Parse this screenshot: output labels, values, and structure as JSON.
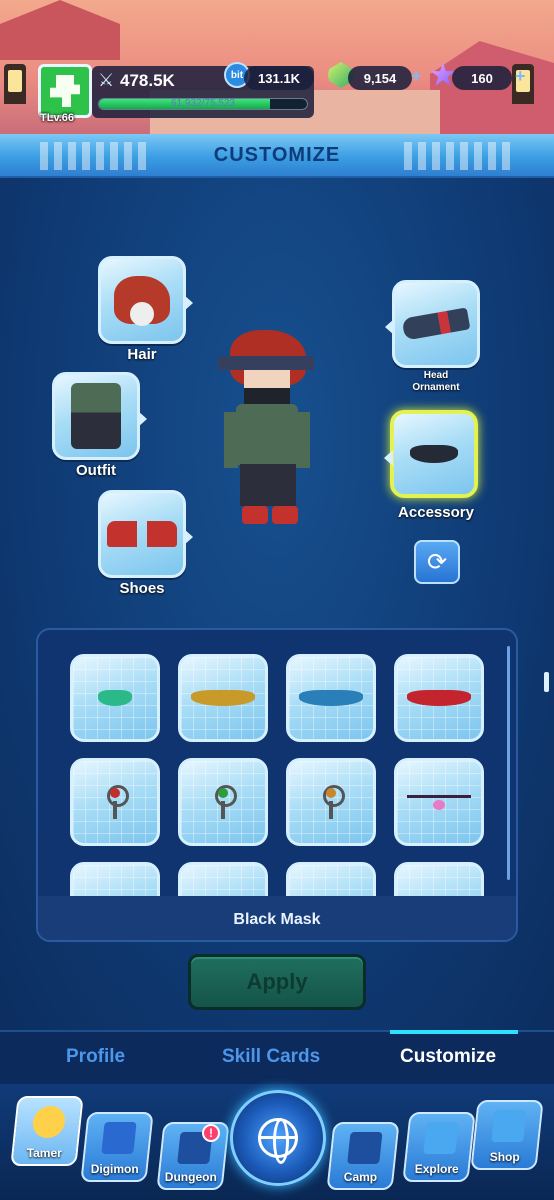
{
  "status": {
    "tamer_level": "TLv.66",
    "power": "478.5K",
    "exp_text": "61,932/75,523",
    "exp_fraction": 0.82,
    "bits": "131.1K",
    "bit_icon_label": "bit",
    "gems": "9,154",
    "stars": "160"
  },
  "header": {
    "title": "CUSTOMIZE"
  },
  "slots": {
    "hair": "Hair",
    "outfit": "Outfit",
    "shoes": "Shoes",
    "head_ornament_line1": "Head",
    "head_ornament_line2": "Ornament",
    "accessory": "Accessory"
  },
  "items": {
    "row1": [
      {
        "icon": "green-mask-icon",
        "color": "#2bb98a"
      },
      {
        "icon": "gold-mask-icon",
        "color": "#c89a2a"
      },
      {
        "icon": "blue-mask-icon",
        "color": "#2a7fb8"
      },
      {
        "icon": "red-mask-icon",
        "color": "#c3242d"
      }
    ],
    "row2": [
      {
        "icon": "red-charm-icon",
        "color": "#c0302d"
      },
      {
        "icon": "green-charm-icon",
        "color": "#2f9a3a"
      },
      {
        "icon": "orange-charm-icon",
        "color": "#c8872a"
      },
      {
        "icon": "glasses-icon",
        "color": "#e87ac8"
      }
    ],
    "selected_name": "Black Mask"
  },
  "apply_label": "Apply",
  "tabs": {
    "profile": "Profile",
    "skill_cards": "Skill Cards",
    "customize": "Customize"
  },
  "nav": {
    "tamer": "Tamer",
    "digimon": "Digimon",
    "dungeon": "Dungeon",
    "camp": "Camp",
    "explore": "Explore",
    "shop": "Shop",
    "dungeon_badge": "!"
  },
  "colors": {
    "accent": "#2fe0ff",
    "selected_border": "#e2f251",
    "title_text": "#0f3b7a"
  }
}
